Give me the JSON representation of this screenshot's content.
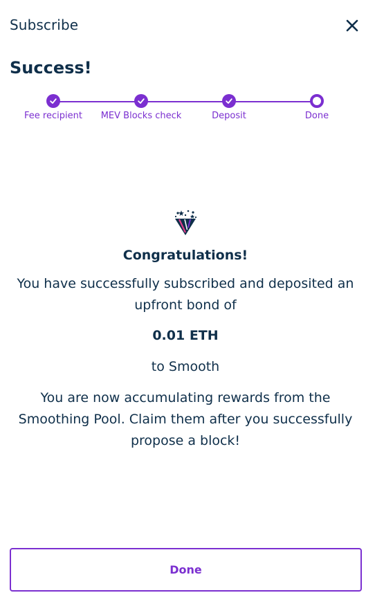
{
  "header": {
    "title": "Subscribe",
    "close_icon": "close-icon"
  },
  "page": {
    "heading": "Success!"
  },
  "stepper": {
    "accent_color": "#7b2fd0",
    "steps": [
      {
        "label": "Fee recipient",
        "status": "complete"
      },
      {
        "label": "MEV Blocks check",
        "status": "complete"
      },
      {
        "label": "Deposit",
        "status": "complete"
      },
      {
        "label": "Done",
        "status": "current"
      }
    ]
  },
  "content": {
    "icon": "party-popper-icon",
    "congrats": "Congratulations!",
    "line1": "You have successfully subscribed and deposited an upfront bond of",
    "amount": "0.01 ETH",
    "line2": "to Smooth",
    "line3": "You are now accumulating rewards from the Smoothing Pool. Claim them after you successfully propose a block!"
  },
  "footer": {
    "done_label": "Done"
  },
  "colors": {
    "text": "#0f2f4a",
    "accent": "#7b2fd0",
    "background": "#ffffff"
  }
}
